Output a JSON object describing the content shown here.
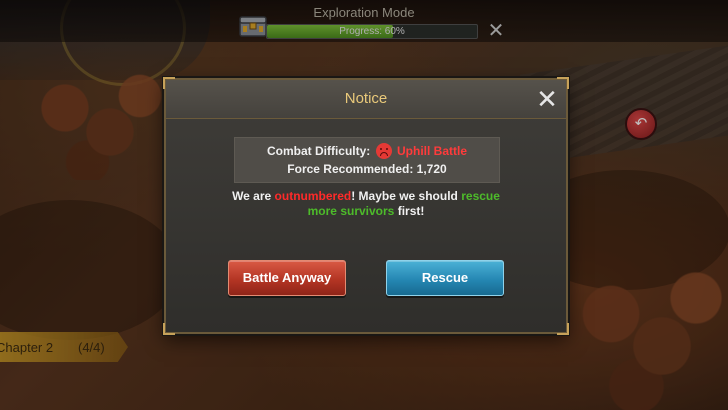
{
  "top_bar": {
    "mode_title": "Exploration Mode",
    "progress_text": "Progress: 60%",
    "progress_value": 0.6,
    "close_icon": "close-icon",
    "chest_icon": "supply-chest-icon"
  },
  "chapter": {
    "label": "Chapter 2",
    "count": "(4/4)"
  },
  "map_badge": {
    "icon": "return-arrow-icon",
    "glyph": "↶"
  },
  "dialog": {
    "title": "Notice",
    "close_glyph": "✕",
    "difficulty_label": "Combat Difficulty:",
    "difficulty_value": "Uphill Battle",
    "force_label": "Force Recommended:",
    "force_value": "1,720",
    "message": {
      "part1": "We are ",
      "part2_red": "outnumbered",
      "part3": "! Maybe we should ",
      "part4_green": "rescue more survivors",
      "part5": " first!"
    },
    "battle_button": "Battle Anyway",
    "rescue_button": "Rescue"
  },
  "colors": {
    "title_gold": "#e9c97a",
    "danger_red": "#ff2a2a",
    "success_green": "#4dbb2a",
    "battle_button": "#b43524",
    "rescue_button": "#2587b3",
    "progress_green": "#7fc23a"
  }
}
